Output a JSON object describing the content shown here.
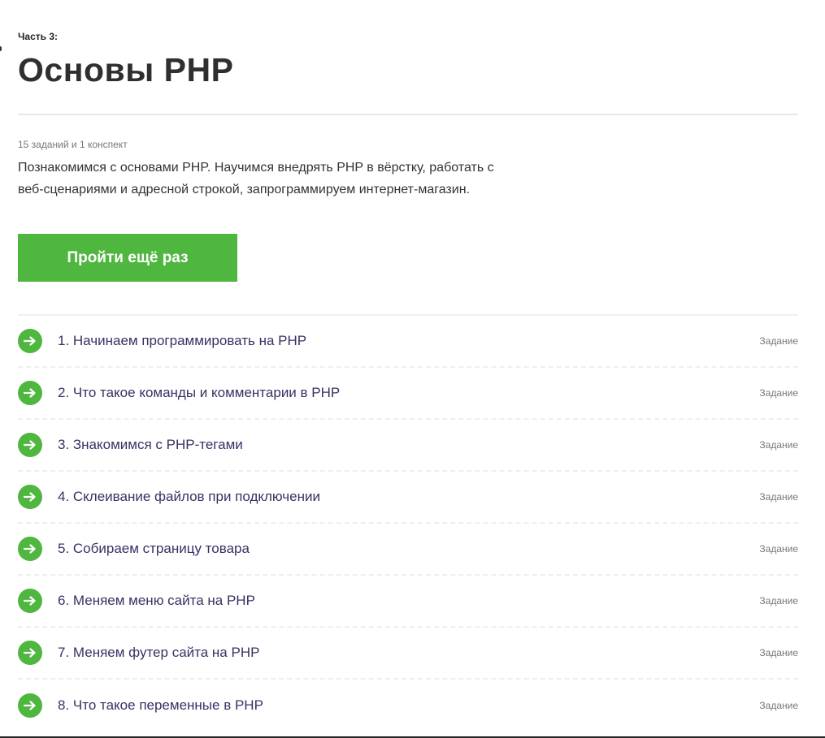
{
  "header": {
    "part_label": "Часть 3:",
    "title": "Основы PHP"
  },
  "summary": {
    "meta": "15 заданий и 1 конспект",
    "description": "Познакомимся с основами PHP. Научимся внедрять PHP в вёрстку, работать с веб-сценариями и адресной строкой, запрограммируем интернет-магазин."
  },
  "actions": {
    "retry_label": "Пройти ещё раз"
  },
  "colors": {
    "accent": "#4fb63f",
    "item_text": "#3a3163"
  },
  "tasks": [
    {
      "title": "1. Начинаем программировать на PHP",
      "type": "Задание",
      "icon": "arrow-right-icon"
    },
    {
      "title": "2. Что такое команды и комментарии в PHP",
      "type": "Задание",
      "icon": "arrow-right-icon"
    },
    {
      "title": "3. Знакомимся с PHP-тегами",
      "type": "Задание",
      "icon": "arrow-right-icon"
    },
    {
      "title": "4. Склеивание файлов при подключении",
      "type": "Задание",
      "icon": "arrow-right-icon"
    },
    {
      "title": "5. Собираем страницу товара",
      "type": "Задание",
      "icon": "arrow-right-icon"
    },
    {
      "title": "6. Меняем меню сайта на PHP",
      "type": "Задание",
      "icon": "arrow-right-icon"
    },
    {
      "title": "7. Меняем футер сайта на PHP",
      "type": "Задание",
      "icon": "arrow-right-icon"
    },
    {
      "title": "8. Что такое переменные в PHP",
      "type": "Задание",
      "icon": "arrow-right-icon"
    }
  ]
}
